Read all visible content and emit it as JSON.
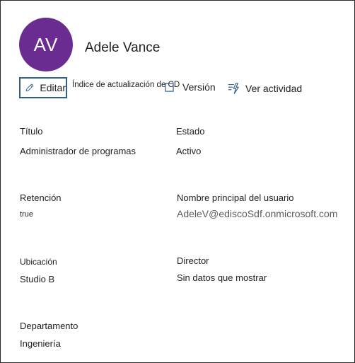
{
  "profile": {
    "initials": "AV",
    "name": "Adele Vance",
    "avatar_color": "#6b2c91"
  },
  "toolbar": {
    "edit_label": "Editar",
    "cd_index_label": "Índice de actualización de CD",
    "version_label": "Versión",
    "activity_label": "Ver actividad",
    "accent_color": "#2f5f8a"
  },
  "fields": {
    "title_label": "Título",
    "title_value": "Administrador de programas",
    "status_label": "Estado",
    "status_value": "Activo",
    "retention_label": "Retención",
    "retention_value": "true",
    "upn_label": "Nombre principal del usuario",
    "upn_value": "AdeleV@ediscoSdf.onmicrosoft.com",
    "location_label": "Ubicación",
    "location_value": "Studio B",
    "director_label": "Director",
    "director_value": "Sin datos que mostrar",
    "department_label": "Departamento",
    "department_value": "Ingeniería"
  },
  "icons": {
    "edit": "pencil-icon",
    "version": "square-icon",
    "activity": "activity-icon"
  }
}
